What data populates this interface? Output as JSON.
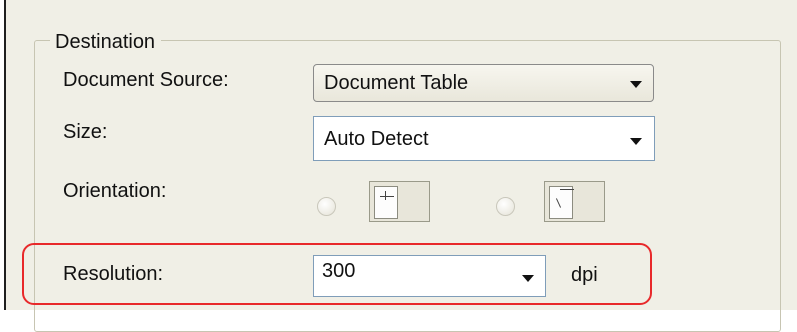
{
  "destination": {
    "group_title": "Destination",
    "document_source": {
      "label": "Document Source:",
      "value": "Document Table"
    },
    "size": {
      "label": "Size:",
      "value": "Auto Detect"
    },
    "orientation": {
      "label": "Orientation:",
      "options": [
        "portrait-icon",
        "landscape-icon"
      ]
    },
    "resolution": {
      "label": "Resolution:",
      "value": "300",
      "unit": "dpi"
    }
  },
  "colors": {
    "highlight": "#e8292b",
    "panel": "#f0efe6",
    "field_border": "#7f9db9"
  }
}
